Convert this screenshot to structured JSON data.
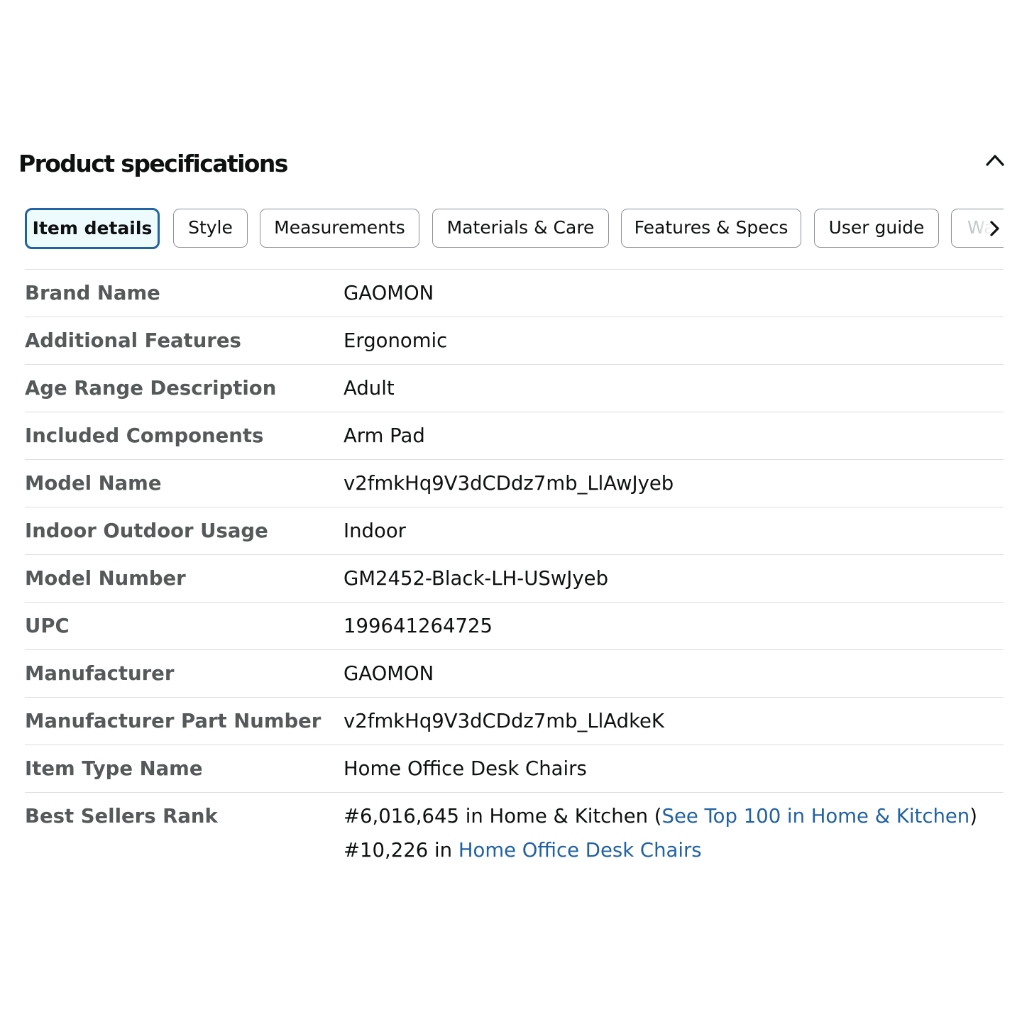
{
  "section": {
    "title": "Product specifications"
  },
  "tabs": [
    {
      "label": "Item details",
      "active": true
    },
    {
      "label": "Style",
      "active": false
    },
    {
      "label": "Measurements",
      "active": false
    },
    {
      "label": "Materials & Care",
      "active": false
    },
    {
      "label": "Features & Specs",
      "active": false
    },
    {
      "label": "User guide",
      "active": false
    },
    {
      "label": "Wa",
      "active": false
    }
  ],
  "specs": [
    {
      "label": "Brand Name",
      "value": "GAOMON"
    },
    {
      "label": "Additional Features",
      "value": "Ergonomic"
    },
    {
      "label": "Age Range Description",
      "value": "Adult"
    },
    {
      "label": "Included Components",
      "value": "Arm Pad"
    },
    {
      "label": "Model Name",
      "value": "v2fmkHq9V3dCDdz7mb_LlAwJyeb"
    },
    {
      "label": "Indoor Outdoor Usage",
      "value": "Indoor"
    },
    {
      "label": "Model Number",
      "value": "GM2452-Black-LH-USwJyeb"
    },
    {
      "label": "UPC",
      "value": "199641264725"
    },
    {
      "label": "Manufacturer",
      "value": "GAOMON"
    },
    {
      "label": "Manufacturer Part Number",
      "value": "v2fmkHq9V3dCDdz7mb_LlAdkeK"
    },
    {
      "label": "Item Type Name",
      "value": "Home Office Desk Chairs"
    }
  ],
  "best_sellers": {
    "label": "Best Sellers Rank",
    "line1_prefix": "#6,016,645 in Home & Kitchen (",
    "line1_link": "See Top 100 in Home & Kitchen",
    "line1_suffix": ")",
    "line2_prefix": "#10,226 in ",
    "line2_link": "Home Office Desk Chairs"
  },
  "icons": {
    "collapse": "chevron-up-icon",
    "scroll_tabs": "chevron-right-icon"
  },
  "colors": {
    "link": "#2162a1",
    "active_tab_border": "#2162a1",
    "active_tab_background": "#edfafe",
    "label_text": "#565959",
    "value_text": "#0f1111"
  }
}
